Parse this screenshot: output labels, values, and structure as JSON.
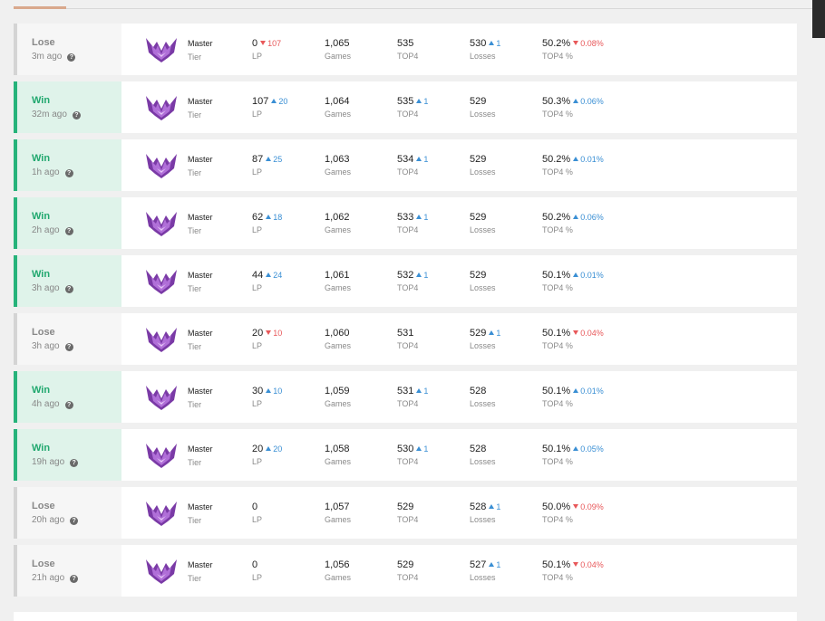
{
  "labels": {
    "lp": "LP",
    "games": "Games",
    "top4": "TOP4",
    "losses": "Losses",
    "top4pct": "TOP4 %",
    "help": "?"
  },
  "colors": {
    "win": "#26b37a",
    "lose": "#d4d4d4",
    "up": "#3a8fd4",
    "down": "#e8585a",
    "tier_icon": "#7a3aa6"
  },
  "matches": [
    {
      "result": "Lose",
      "time": "3m ago",
      "tier": "Master",
      "tier_label": "Tier",
      "lp": "0",
      "lp_delta": "107",
      "lp_dir": "down",
      "games": "1,065",
      "top4": "535",
      "top4_delta": "",
      "losses": "530",
      "losses_delta": "1",
      "pct": "50.2%",
      "pct_delta": "0.08%",
      "pct_dir": "down"
    },
    {
      "result": "Win",
      "time": "32m ago",
      "tier": "Master",
      "tier_label": "Tier",
      "lp": "107",
      "lp_delta": "20",
      "lp_dir": "up",
      "games": "1,064",
      "top4": "535",
      "top4_delta": "1",
      "losses": "529",
      "losses_delta": "",
      "pct": "50.3%",
      "pct_delta": "0.06%",
      "pct_dir": "up"
    },
    {
      "result": "Win",
      "time": "1h ago",
      "tier": "Master",
      "tier_label": "Tier",
      "lp": "87",
      "lp_delta": "25",
      "lp_dir": "up",
      "games": "1,063",
      "top4": "534",
      "top4_delta": "1",
      "losses": "529",
      "losses_delta": "",
      "pct": "50.2%",
      "pct_delta": "0.01%",
      "pct_dir": "up"
    },
    {
      "result": "Win",
      "time": "2h ago",
      "tier": "Master",
      "tier_label": "Tier",
      "lp": "62",
      "lp_delta": "18",
      "lp_dir": "up",
      "games": "1,062",
      "top4": "533",
      "top4_delta": "1",
      "losses": "529",
      "losses_delta": "",
      "pct": "50.2%",
      "pct_delta": "0.06%",
      "pct_dir": "up"
    },
    {
      "result": "Win",
      "time": "3h ago",
      "tier": "Master",
      "tier_label": "Tier",
      "lp": "44",
      "lp_delta": "24",
      "lp_dir": "up",
      "games": "1,061",
      "top4": "532",
      "top4_delta": "1",
      "losses": "529",
      "losses_delta": "",
      "pct": "50.1%",
      "pct_delta": "0.01%",
      "pct_dir": "up"
    },
    {
      "result": "Lose",
      "time": "3h ago",
      "tier": "Master",
      "tier_label": "Tier",
      "lp": "20",
      "lp_delta": "10",
      "lp_dir": "down",
      "games": "1,060",
      "top4": "531",
      "top4_delta": "",
      "losses": "529",
      "losses_delta": "1",
      "pct": "50.1%",
      "pct_delta": "0.04%",
      "pct_dir": "down"
    },
    {
      "result": "Win",
      "time": "4h ago",
      "tier": "Master",
      "tier_label": "Tier",
      "lp": "30",
      "lp_delta": "10",
      "lp_dir": "up",
      "games": "1,059",
      "top4": "531",
      "top4_delta": "1",
      "losses": "528",
      "losses_delta": "",
      "pct": "50.1%",
      "pct_delta": "0.01%",
      "pct_dir": "up"
    },
    {
      "result": "Win",
      "time": "19h ago",
      "tier": "Master",
      "tier_label": "Tier",
      "lp": "20",
      "lp_delta": "20",
      "lp_dir": "up",
      "games": "1,058",
      "top4": "530",
      "top4_delta": "1",
      "losses": "528",
      "losses_delta": "",
      "pct": "50.1%",
      "pct_delta": "0.05%",
      "pct_dir": "up"
    },
    {
      "result": "Lose",
      "time": "20h ago",
      "tier": "Master",
      "tier_label": "Tier",
      "lp": "0",
      "lp_delta": "",
      "lp_dir": "",
      "games": "1,057",
      "top4": "529",
      "top4_delta": "",
      "losses": "528",
      "losses_delta": "1",
      "pct": "50.0%",
      "pct_delta": "0.09%",
      "pct_dir": "down"
    },
    {
      "result": "Lose",
      "time": "21h ago",
      "tier": "Master",
      "tier_label": "Tier",
      "lp": "0",
      "lp_delta": "",
      "lp_dir": "",
      "games": "1,056",
      "top4": "529",
      "top4_delta": "",
      "losses": "527",
      "losses_delta": "1",
      "pct": "50.1%",
      "pct_delta": "0.04%",
      "pct_dir": "down"
    }
  ]
}
